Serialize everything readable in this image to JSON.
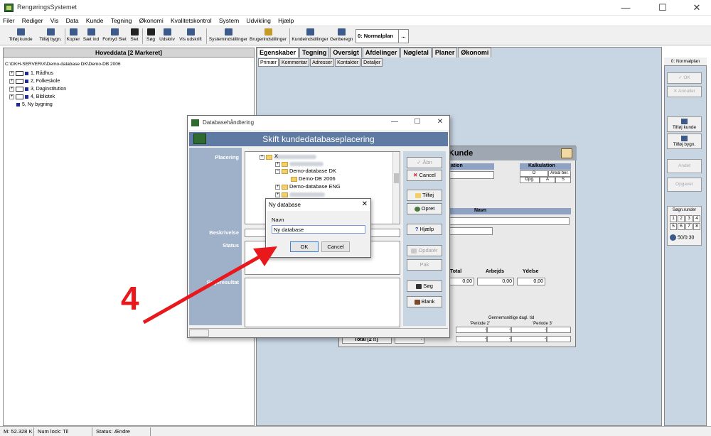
{
  "window": {
    "title": "RengøringsSystemet",
    "controls": [
      "—",
      "☐",
      "✕"
    ]
  },
  "menu": [
    "Filer",
    "Rediger",
    "Vis",
    "Data",
    "Kunde",
    "Tegning",
    "Økonomi",
    "Kvalitetskontrol",
    "System",
    "Udvikling",
    "Hjælp"
  ],
  "toolbar": {
    "buttons": [
      "Tilføj kunde",
      "Tilføj bygn.",
      "Kopier",
      "Sæt ind",
      "Fortryd Slet",
      "Slet",
      "Søg",
      "Udskriv",
      "Vis udskrift",
      "Systemindstillinger",
      "Brugerindstillinger",
      "Kundeindstillinger",
      "Genberegn"
    ],
    "plan": "0: Normalplan",
    "plan_dots": "..."
  },
  "left_panel": {
    "header": "Hoveddata  [2 Markeret]",
    "path": "C:\\DKH-SERVER\\X\\Demo-database DK\\Demo-DB 2006",
    "items": [
      "1, Rådhus",
      "2, Folkeskole",
      "3, Daginstitution",
      "4, Bibliotek",
      "5, Ny bygning"
    ]
  },
  "tabs": {
    "main": [
      "Egenskaber",
      "Tegning",
      "Oversigt",
      "Afdelinger",
      "Nøgletal",
      "Planer",
      "Økonomi"
    ],
    "sub": [
      "Primær",
      "Kommentar",
      "Adresser",
      "Kontakter",
      "Detaljer"
    ]
  },
  "kunde_form": {
    "title": "Kunde",
    "ation_label": "ation",
    "kalkulation": {
      "title": "Kalkulation",
      "headers": [
        "O",
        "Areal ber."
      ],
      "row": [
        "Opg.",
        "A",
        "S"
      ]
    },
    "navn_header": "Navn",
    "totals": {
      "headers": [
        "Total",
        "Arbejds",
        "Ydelse"
      ],
      "values": [
        "0,00",
        "0,00",
        "0,00"
      ]
    },
    "period_header": "Gennemsnitlige dagl. tid",
    "periods": [
      "'Periode 2'",
      "'Periode 3'"
    ],
    "dashes": [
      "-",
      "-",
      "-",
      "-",
      "-",
      "-",
      "-"
    ],
    "total_row": "Total [2 !!]"
  },
  "right_sidebar": {
    "plan_label": "0: Normalplan",
    "buttons": [
      "OK",
      "Annuller",
      "Tilføj kunde",
      "Tilføj bygn.",
      "Andet",
      "Opgaver"
    ],
    "soeg_label": "Søgn.runder",
    "numbers": [
      "1",
      "2",
      "3",
      "4",
      "5",
      "6",
      "7",
      "8"
    ],
    "time": "50/0:30"
  },
  "statusbar": [
    "M: 52.328 K",
    "Num lock: Til",
    "Status: Ændre"
  ],
  "db_dialog": {
    "window_title": "Databasehåndtering",
    "banner": "Skift kundedatabaseplacering",
    "labels": [
      "Placering",
      "Beskrivelse",
      "Status",
      "Søgeresultat"
    ],
    "tree": [
      "X",
      "Demo-database DK",
      "Demo-DB 2006",
      "Demo-database ENG"
    ],
    "buttons": [
      "Åbn",
      "Cancel",
      "Tilføj",
      "Opret",
      "Hjælp",
      "Opdatér",
      "Pak",
      "Søg",
      "Blank"
    ]
  },
  "ny_dialog": {
    "title": "Ny database",
    "field_label": "Navn",
    "field_value": "Ny database",
    "ok": "OK",
    "cancel": "Cancel"
  },
  "annotation": {
    "number": "4",
    "color": "#e8181c"
  },
  "colors": {
    "panel_blue": "#c8d6e4",
    "banner_blue": "#5f7aa3",
    "tree_square": "#1c2a9a"
  }
}
